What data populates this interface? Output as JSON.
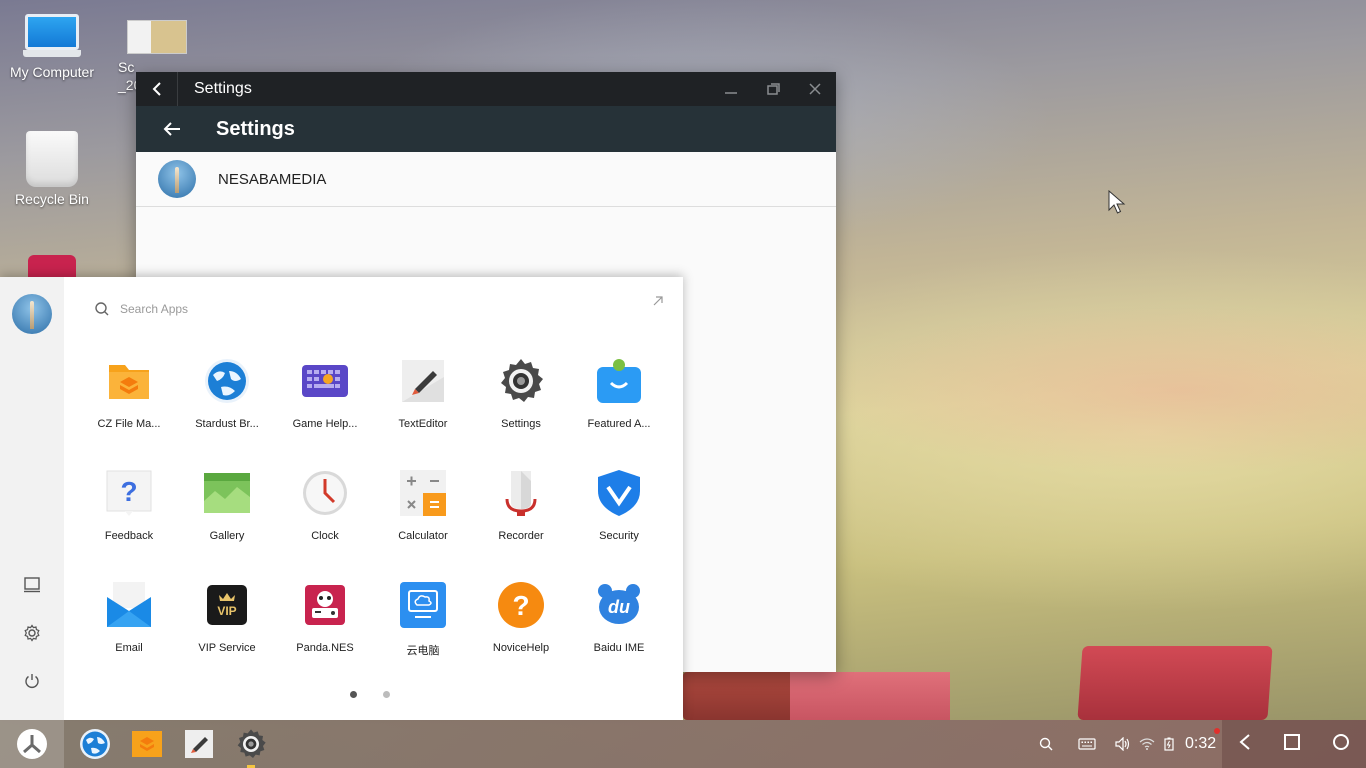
{
  "desktop": {
    "icons": [
      {
        "label": "My Computer"
      },
      {
        "label": "Sc\n_20"
      },
      {
        "label": "Recycle Bin"
      }
    ]
  },
  "settings_window": {
    "title": "Settings",
    "header_title": "Settings",
    "account_name": "NESABAMEDIA"
  },
  "start_menu": {
    "search_placeholder": "Search Apps",
    "apps": [
      {
        "label": "CZ File Ma...",
        "icon": "folder-icon"
      },
      {
        "label": "Stardust Br...",
        "icon": "globe-icon"
      },
      {
        "label": "Game Help...",
        "icon": "keyboard-icon"
      },
      {
        "label": "TextEditor",
        "icon": "text-editor-icon"
      },
      {
        "label": "Settings",
        "icon": "gear-icon"
      },
      {
        "label": "Featured A...",
        "icon": "store-bag-icon"
      },
      {
        "label": "Feedback",
        "icon": "question-icon"
      },
      {
        "label": "Gallery",
        "icon": "gallery-icon"
      },
      {
        "label": "Clock",
        "icon": "clock-icon"
      },
      {
        "label": "Calculator",
        "icon": "calculator-icon"
      },
      {
        "label": "Recorder",
        "icon": "recorder-icon"
      },
      {
        "label": "Security",
        "icon": "shield-icon"
      },
      {
        "label": "Email",
        "icon": "mail-icon"
      },
      {
        "label": "VIP Service",
        "icon": "vip-icon"
      },
      {
        "label": "Panda.NES",
        "icon": "panda-icon"
      },
      {
        "label": "云电脑",
        "icon": "cloud-pc-icon"
      },
      {
        "label": "NoviceHelp",
        "icon": "help-icon"
      },
      {
        "label": "Baidu IME",
        "icon": "baidu-icon"
      }
    ],
    "page_count": 2,
    "current_page": 1
  },
  "taskbar": {
    "clock": "0:32"
  },
  "colors": {
    "window_title_bg": "#1f2225",
    "window_header_bg": "#263238",
    "start_sidebar_bg": "#f2f2f2"
  }
}
